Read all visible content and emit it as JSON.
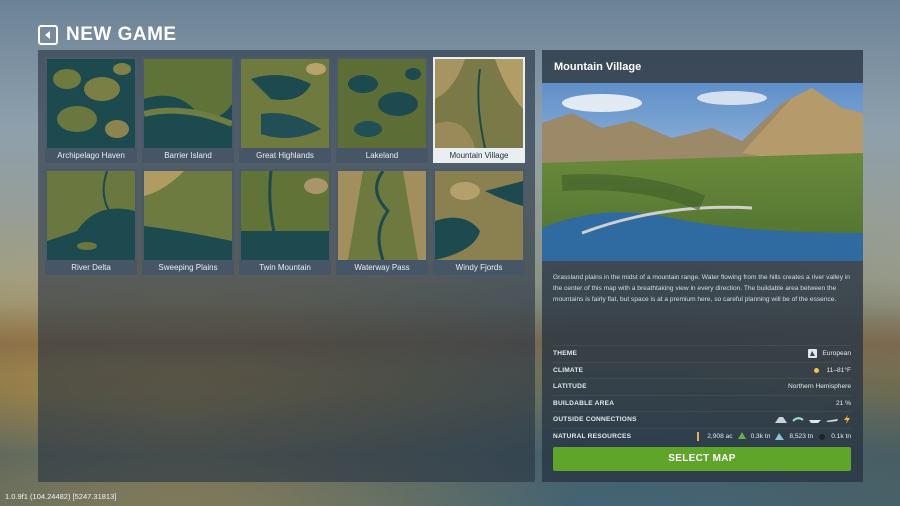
{
  "header": {
    "title": "NEW GAME"
  },
  "maps": [
    {
      "name": "Archipelago Haven",
      "selected": false
    },
    {
      "name": "Barrier Island",
      "selected": false
    },
    {
      "name": "Great Highlands",
      "selected": false
    },
    {
      "name": "Lakeland",
      "selected": false
    },
    {
      "name": "Mountain Village",
      "selected": true
    },
    {
      "name": "River Delta",
      "selected": false
    },
    {
      "name": "Sweeping Plains",
      "selected": false
    },
    {
      "name": "Twin Mountain",
      "selected": false
    },
    {
      "name": "Waterway Pass",
      "selected": false
    },
    {
      "name": "Windy Fjords",
      "selected": false
    }
  ],
  "details": {
    "title": "Mountain Village",
    "description": "Grassland plains in the midst of a mountain range. Water flowing from the hills creates a river valley in the center of this map with a breathtaking view in every direction. The buildable area between the mountains is fairly flat, but space is at a premium here, so careful planning will be of the essence.",
    "theme_label": "THEME",
    "theme_value": "European",
    "climate_label": "CLIMATE",
    "climate_value": "11–81°F",
    "latitude_label": "LATITUDE",
    "latitude_value": "Northern Hemisphere",
    "buildable_label": "BUILDABLE AREA",
    "buildable_value": "21 %",
    "connections_label": "OUTSIDE CONNECTIONS",
    "connections_icons": [
      "road-icon",
      "train-icon",
      "ship-icon",
      "plane-icon",
      "power-icon"
    ],
    "resources_label": "NATURAL RESOURCES",
    "resources": [
      {
        "icon": "fertile-land-icon",
        "value": "2,908 ac"
      },
      {
        "icon": "forest-icon",
        "value": "0.3k tn"
      },
      {
        "icon": "ore-icon",
        "value": "8,523 tn"
      },
      {
        "icon": "oil-icon",
        "value": "0.1k tn"
      }
    ]
  },
  "select_button": "SELECT MAP",
  "version": "1.0.9f1 (104.24482) [5247.31813]",
  "colors": {
    "accent_green": "#5ea52a",
    "panel": "#28343f",
    "water": "#1f4a55",
    "land": "#6b7a3c"
  }
}
